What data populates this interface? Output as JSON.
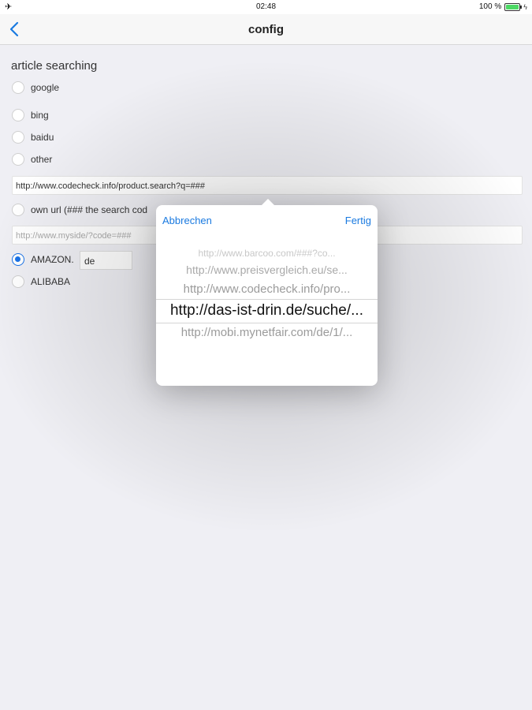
{
  "statusbar": {
    "time": "02:48",
    "battery": "100 %",
    "airplane_icon": "airplane-icon",
    "battery_color": "#4cd964"
  },
  "nav": {
    "title": "config",
    "back_icon": "chevron-left-icon"
  },
  "form": {
    "section_title": "article searching",
    "engines": [
      {
        "label": "google",
        "selected": false
      },
      {
        "label": "bing",
        "selected": false
      },
      {
        "label": "baidu",
        "selected": false
      },
      {
        "label": "other",
        "selected": false
      }
    ],
    "other_url_value": "http://www.codecheck.info/product.search?q=###",
    "own_url_label": "own url (### the search cod",
    "own_url_placeholder": "http://www.myside/?code=###",
    "stores": [
      {
        "label": "AMAZON.",
        "selected": true
      },
      {
        "label": "ALIBABA",
        "selected": false
      }
    ],
    "amazon_domain": "de"
  },
  "popover": {
    "cancel_label": "Abbrechen",
    "done_label": "Fertig",
    "options": [
      "http://www.barcoo.com/###?co...",
      "http://www.preisvergleich.eu/se...",
      "http://www.codecheck.info/pro...",
      "http://das-ist-drin.de/suche/...",
      "http://mobi.mynetfair.com/de/1/..."
    ],
    "selected_index": 3
  },
  "colors": {
    "accent": "#1a7ae0",
    "background": "#efeff4"
  }
}
